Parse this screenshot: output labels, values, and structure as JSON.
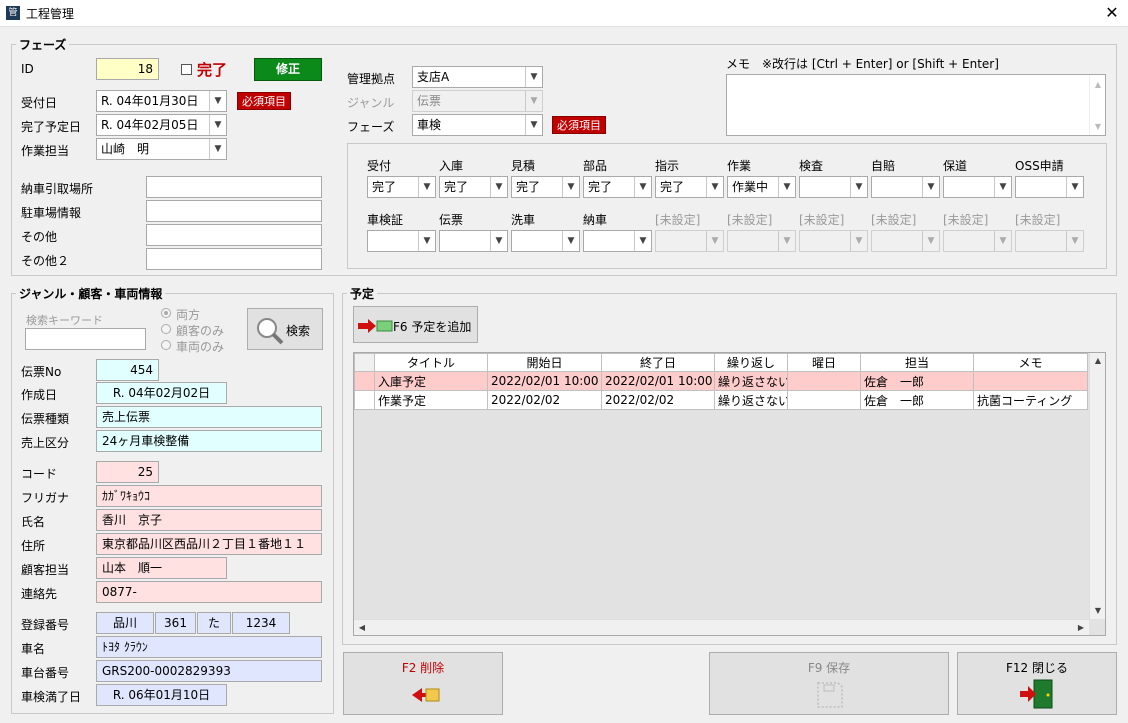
{
  "window": {
    "title": "工程管理",
    "icon_label": "管",
    "close_label": "✕"
  },
  "phase": {
    "legend": "フェーズ",
    "id_label": "ID",
    "id_value": "18",
    "complete_label": "完了",
    "edit_button": "修正",
    "received_label": "受付日",
    "received_value": "R. 04年01月30日",
    "required_tag": "必須項目",
    "due_label": "完了予定日",
    "due_value": "R. 04年02月05日",
    "worker_label": "作業担当",
    "worker_value": "山崎　明",
    "base_label": "管理拠点",
    "base_value": "支店A",
    "genre_label": "ジャンル",
    "genre_value": "伝票",
    "phase_label": "フェーズ",
    "phase_value": "車検",
    "memo_label": "メモ　※改行は [Ctrl + Enter] or [Shift + Enter]",
    "delivery_label": "納車引取場所",
    "parking_label": "駐車場情報",
    "other_label": "その他",
    "other2_label": "その他２",
    "steps_row1": [
      {
        "label": "受付",
        "value": "完了"
      },
      {
        "label": "入庫",
        "value": "完了"
      },
      {
        "label": "見積",
        "value": "完了"
      },
      {
        "label": "部品",
        "value": "完了"
      },
      {
        "label": "指示",
        "value": "完了"
      },
      {
        "label": "作業",
        "value": "作業中"
      },
      {
        "label": "検査",
        "value": ""
      },
      {
        "label": "自賠",
        "value": ""
      },
      {
        "label": "保道",
        "value": ""
      },
      {
        "label": "OSS申請",
        "value": ""
      }
    ],
    "steps_row2": [
      {
        "label": "車検証",
        "value": ""
      },
      {
        "label": "伝票",
        "value": ""
      },
      {
        "label": "洗車",
        "value": ""
      },
      {
        "label": "納車",
        "value": ""
      },
      {
        "label": "[未設定]",
        "value": ""
      },
      {
        "label": "[未設定]",
        "value": ""
      },
      {
        "label": "[未設定]",
        "value": ""
      },
      {
        "label": "[未設定]",
        "value": ""
      },
      {
        "label": "[未設定]",
        "value": ""
      },
      {
        "label": "[未設定]",
        "value": ""
      }
    ]
  },
  "customer": {
    "legend": "ジャンル・顧客・車両情報",
    "search_keyword_label": "検索キーワード",
    "radio_both": "両方",
    "radio_customer": "顧客のみ",
    "radio_vehicle": "車両のみ",
    "search_button": "検索",
    "slip_no_label": "伝票No",
    "slip_no": "454",
    "created_label": "作成日",
    "created": "R. 04年02月02日",
    "slip_type_label": "伝票種類",
    "slip_type": "売上伝票",
    "sales_cat_label": "売上区分",
    "sales_cat": "24ヶ月車検整備",
    "code_label": "コード",
    "code": "25",
    "furigana_label": "フリガナ",
    "furigana": "ｶｶﾞﾜｷｮｳｺ",
    "name_label": "氏名",
    "name": "香川　京子",
    "address_label": "住所",
    "address": "東京都品川区西品川２丁目１番地１１",
    "cust_rep_label": "顧客担当",
    "cust_rep": "山本　順一",
    "contact_label": "連絡先",
    "contact": "0877-",
    "reg_no_label": "登録番号",
    "reg_area": "品川",
    "reg_class": "361",
    "reg_kana": "た",
    "reg_num": "1234",
    "car_name_label": "車名",
    "car_name": "ﾄﾖﾀ ｸﾗｳﾝ",
    "chassis_label": "車台番号",
    "chassis": "GRS200-0002829393",
    "inspection_label": "車検満了日",
    "inspection": "R. 06年01月10日"
  },
  "schedule": {
    "legend": "予定",
    "add_button": "F6 予定を追加",
    "columns": [
      "タイトル",
      "開始日",
      "終了日",
      "繰り返し",
      "曜日",
      "担当",
      "メモ"
    ],
    "rows": [
      [
        "入庫予定",
        "2022/02/01 10:00",
        "2022/02/01 10:00",
        "繰り返さない",
        "",
        "佐倉　一郎",
        ""
      ],
      [
        "作業予定",
        "2022/02/02",
        "2022/02/02",
        "繰り返さない",
        "",
        "佐倉　一郎",
        "抗菌コーティング"
      ]
    ]
  },
  "footer": {
    "delete_button": "F2 削除",
    "save_button": "F9 保存",
    "close_button": "F12 閉じる"
  },
  "colors": {
    "required": "#c00000",
    "edit_green": "#0b8a1a",
    "selected_row": "#ffcccc"
  }
}
